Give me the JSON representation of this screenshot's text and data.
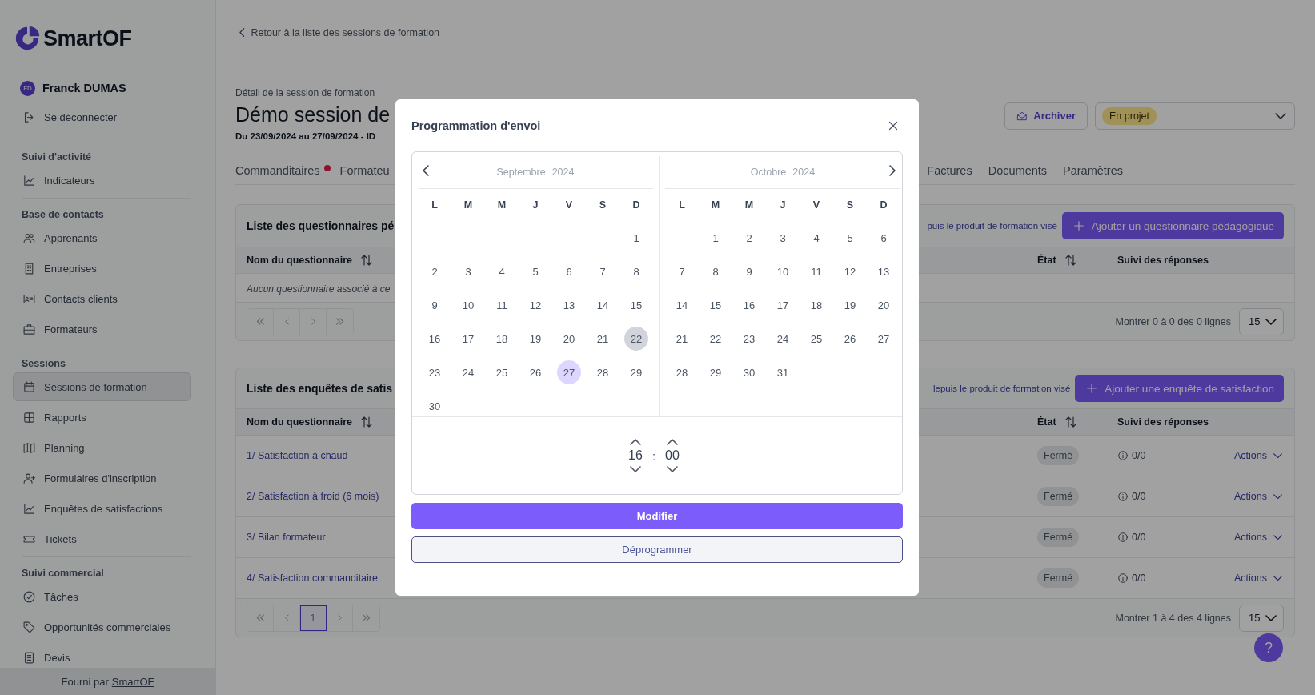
{
  "sidebar": {
    "logo": "SmartOF",
    "user": {
      "initials": "FD",
      "name": "Franck DUMAS"
    },
    "logout": "Se déconnecter",
    "sections": [
      {
        "title": "Suivi d'activité",
        "items": [
          {
            "label": "Indicateurs",
            "selected": false
          }
        ]
      },
      {
        "title": "Base de contacts",
        "items": [
          {
            "label": "Apprenants",
            "selected": false
          },
          {
            "label": "Entreprises",
            "selected": false
          },
          {
            "label": "Contacts clients",
            "selected": false
          },
          {
            "label": "Formateurs",
            "selected": false
          }
        ]
      },
      {
        "title": "Sessions",
        "items": [
          {
            "label": "Sessions de formation",
            "selected": true
          },
          {
            "label": "Rapports",
            "selected": false
          },
          {
            "label": "Planning",
            "selected": false
          },
          {
            "label": "Formulaires d'inscription",
            "selected": false
          },
          {
            "label": "Enquêtes de satisfactions",
            "selected": false
          },
          {
            "label": "Tickets",
            "selected": false
          }
        ]
      },
      {
        "title": "Suivi commercial",
        "items": [
          {
            "label": "Tâches",
            "selected": false
          },
          {
            "label": "Opportunités commerciales",
            "selected": false
          },
          {
            "label": "Devis",
            "selected": false
          }
        ]
      }
    ],
    "footer": {
      "text": "Fourni par",
      "link": "SmartOF"
    }
  },
  "header": {
    "back_link": "Retour à la liste des sessions de formation",
    "subtitle": "Détail de la session de formation",
    "title": "Démo session de",
    "dates": "Du 23/09/2024 au 27/09/2024 - ID",
    "archive_button": "Archiver",
    "status": "En projet"
  },
  "tabs": {
    "before_dialog": [
      {
        "label": "Commanditaires",
        "alert": true
      },
      {
        "label": "Formateu",
        "alert": false
      }
    ],
    "after_dialog": [
      {
        "label": "Factures",
        "alert": false
      },
      {
        "label": "Documents",
        "alert": false
      },
      {
        "label": "Paramètres",
        "alert": false
      }
    ]
  },
  "cards": [
    {
      "title": "Liste des questionnaires pé",
      "link": "puis le produit de formation visé",
      "add_button": "Ajouter un questionnaire pédagogique",
      "columns": [
        {
          "label": "Nom du questionnaire",
          "sortable": true
        },
        {
          "label": "État",
          "sortable": true
        },
        {
          "label": "Suivi des réponses",
          "sortable": false
        }
      ],
      "empty": "Aucun questionnaire associé à ce",
      "summary": "Montrer 0 à 0 des 0 lignes",
      "page_size": "15"
    },
    {
      "title": "Liste des enquêtes de satis",
      "link": "lepuis le produit de formation visé",
      "add_button": "Ajouter une enquête de satisfaction",
      "columns": [
        {
          "label": "Nom du questionnaire",
          "sortable": true
        },
        {
          "label": "État",
          "sortable": true
        },
        {
          "label": "Suivi des réponses",
          "sortable": false
        }
      ],
      "rows": [
        {
          "name": "1/ Satisfaction à chaud",
          "state": "Fermé",
          "responses": "0/0",
          "action": "Actions"
        },
        {
          "name": "2/ Satisfaction à froid (6 mois)",
          "state": "Fermé",
          "responses": "0/0",
          "action": "Actions"
        },
        {
          "name": "3/ Bilan formateur",
          "state": "Fermé",
          "responses": "0/0",
          "action": "Actions"
        },
        {
          "name": "4/ Satisfaction commanditaire",
          "state": "Fermé",
          "responses": "0/0",
          "action": "Actions"
        }
      ],
      "pages": [
        {
          "label": "1",
          "selected": true
        }
      ],
      "summary": "Montrer 1 à 4 des 4 lignes",
      "page_size": "15"
    }
  ],
  "modal": {
    "title": "Programmation d'envoi",
    "calendar": {
      "months": [
        {
          "name": "Septembre",
          "year": "2024",
          "weekdays": [
            "L",
            "M",
            "M",
            "J",
            "V",
            "S",
            "D"
          ],
          "weeks": [
            {
              "days": [
                {
                  "d": "1",
                  "selected": false,
                  "today": false
                }
              ]
            },
            {
              "days": [
                {
                  "d": "2",
                  "selected": false,
                  "today": false
                },
                {
                  "d": "3",
                  "selected": false,
                  "today": false
                },
                {
                  "d": "4",
                  "selected": false,
                  "today": false
                },
                {
                  "d": "5",
                  "selected": false,
                  "today": false
                },
                {
                  "d": "6",
                  "selected": false,
                  "today": false
                },
                {
                  "d": "7",
                  "selected": false,
                  "today": false
                },
                {
                  "d": "8",
                  "selected": false,
                  "today": false
                }
              ]
            },
            {
              "days": [
                {
                  "d": "9",
                  "selected": false,
                  "today": false
                },
                {
                  "d": "10",
                  "selected": false,
                  "today": false
                },
                {
                  "d": "11",
                  "selected": false,
                  "today": false
                },
                {
                  "d": "12",
                  "selected": false,
                  "today": false
                },
                {
                  "d": "13",
                  "selected": false,
                  "today": false
                },
                {
                  "d": "14",
                  "selected": false,
                  "today": false
                },
                {
                  "d": "15",
                  "selected": false,
                  "today": false
                }
              ]
            },
            {
              "days": [
                {
                  "d": "16",
                  "selected": false,
                  "today": false
                },
                {
                  "d": "17",
                  "selected": false,
                  "today": false
                },
                {
                  "d": "18",
                  "selected": false,
                  "today": false
                },
                {
                  "d": "19",
                  "selected": false,
                  "today": false
                },
                {
                  "d": "20",
                  "selected": false,
                  "today": false
                },
                {
                  "d": "21",
                  "selected": false,
                  "today": false
                },
                {
                  "d": "22",
                  "selected": false,
                  "today": true
                }
              ]
            },
            {
              "days": [
                {
                  "d": "23",
                  "selected": false,
                  "today": false
                },
                {
                  "d": "24",
                  "selected": false,
                  "today": false
                },
                {
                  "d": "25",
                  "selected": false,
                  "today": false
                },
                {
                  "d": "26",
                  "selected": false,
                  "today": false
                },
                {
                  "d": "27",
                  "selected": true,
                  "today": false
                },
                {
                  "d": "28",
                  "selected": false,
                  "today": false
                },
                {
                  "d": "29",
                  "selected": false,
                  "today": false
                }
              ]
            },
            {
              "days": [
                {
                  "d": "30",
                  "selected": false,
                  "today": false
                }
              ]
            }
          ]
        },
        {
          "name": "Octobre",
          "year": "2024",
          "weekdays": [
            "L",
            "M",
            "M",
            "J",
            "V",
            "S",
            "D"
          ],
          "weeks": [
            {
              "days": [
                {
                  "d": "1",
                  "selected": false,
                  "today": false
                },
                {
                  "d": "2",
                  "selected": false,
                  "today": false
                },
                {
                  "d": "3",
                  "selected": false,
                  "today": false
                },
                {
                  "d": "4",
                  "selected": false,
                  "today": false
                },
                {
                  "d": "5",
                  "selected": false,
                  "today": false
                },
                {
                  "d": "6",
                  "selected": false,
                  "today": false
                }
              ]
            },
            {
              "days": [
                {
                  "d": "7",
                  "selected": false,
                  "today": false
                },
                {
                  "d": "8",
                  "selected": false,
                  "today": false
                },
                {
                  "d": "9",
                  "selected": false,
                  "today": false
                },
                {
                  "d": "10",
                  "selected": false,
                  "today": false
                },
                {
                  "d": "11",
                  "selected": false,
                  "today": false
                },
                {
                  "d": "12",
                  "selected": false,
                  "today": false
                },
                {
                  "d": "13",
                  "selected": false,
                  "today": false
                }
              ]
            },
            {
              "days": [
                {
                  "d": "14",
                  "selected": false,
                  "today": false
                },
                {
                  "d": "15",
                  "selected": false,
                  "today": false
                },
                {
                  "d": "16",
                  "selected": false,
                  "today": false
                },
                {
                  "d": "17",
                  "selected": false,
                  "today": false
                },
                {
                  "d": "18",
                  "selected": false,
                  "today": false
                },
                {
                  "d": "19",
                  "selected": false,
                  "today": false
                },
                {
                  "d": "20",
                  "selected": false,
                  "today": false
                }
              ]
            },
            {
              "days": [
                {
                  "d": "21",
                  "selected": false,
                  "today": false
                },
                {
                  "d": "22",
                  "selected": false,
                  "today": false
                },
                {
                  "d": "23",
                  "selected": false,
                  "today": false
                },
                {
                  "d": "24",
                  "selected": false,
                  "today": false
                },
                {
                  "d": "25",
                  "selected": false,
                  "today": false
                },
                {
                  "d": "26",
                  "selected": false,
                  "today": false
                },
                {
                  "d": "27",
                  "selected": false,
                  "today": false
                }
              ]
            },
            {
              "days": [
                {
                  "d": "28",
                  "selected": false,
                  "today": false
                },
                {
                  "d": "29",
                  "selected": false,
                  "today": false
                },
                {
                  "d": "30",
                  "selected": false,
                  "today": false
                },
                {
                  "d": "31",
                  "selected": false,
                  "today": false
                }
              ]
            }
          ]
        }
      ]
    },
    "time": {
      "hours": "16",
      "separator": ":",
      "minutes": "00"
    },
    "primary_button": "Modifier",
    "secondary_button": "Déprogrammer"
  },
  "help_button": {
    "label": "?"
  }
}
